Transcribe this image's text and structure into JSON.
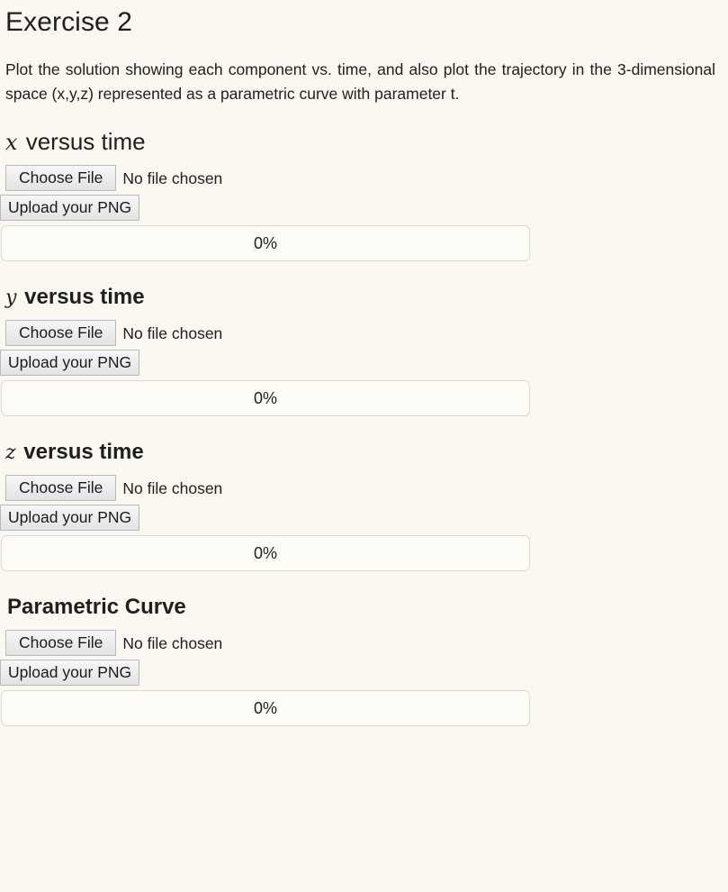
{
  "theme": {
    "background": "#fbf8f1",
    "text": "#1f1f1f",
    "button_border": "#b9b9b9",
    "progress_border": "#dedbd5",
    "progress_background": "#fdfbf6"
  },
  "exercise": {
    "title": "Exercise 2",
    "description": "Plot the solution showing each component vs. time, and also plot the trajectory in the 3-dimensional space (x,y,z) represented as a parametric curve with parameter t."
  },
  "sections": [
    {
      "heading_var": "x",
      "heading_rest": " versus time",
      "heading_level": 2,
      "choose_label": "Choose File",
      "file_status": "No file chosen",
      "upload_label": "Upload your PNG",
      "progress_text": "0%",
      "progress_value": 0
    },
    {
      "heading_var": "y",
      "heading_rest": " versus time",
      "heading_level": 3,
      "choose_label": "Choose File",
      "file_status": "No file chosen",
      "upload_label": "Upload your PNG",
      "progress_text": "0%",
      "progress_value": 0
    },
    {
      "heading_var": "z",
      "heading_rest": " versus time",
      "heading_level": 3,
      "choose_label": "Choose File",
      "file_status": "No file chosen",
      "upload_label": "Upload your PNG",
      "progress_text": "0%",
      "progress_value": 0
    },
    {
      "heading_var": "",
      "heading_rest": "Parametric Curve",
      "heading_level": 3,
      "choose_label": "Choose File",
      "file_status": "No file chosen",
      "upload_label": "Upload your PNG",
      "progress_text": "0%",
      "progress_value": 0
    }
  ]
}
